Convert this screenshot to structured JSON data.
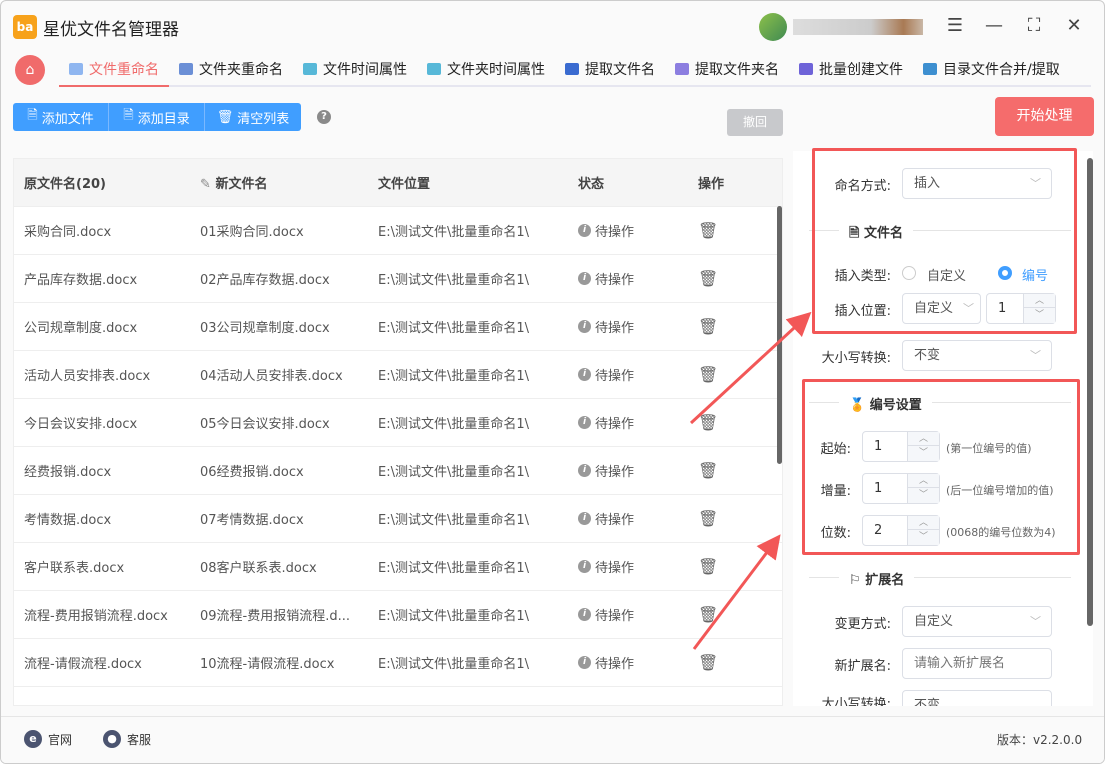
{
  "app": {
    "title": "星优文件名管理器",
    "logo_text": "ba"
  },
  "window_controls": [
    "settings-icon",
    "minimize-icon",
    "maximize-icon",
    "close-icon"
  ],
  "tabs": [
    {
      "label": "文件重命名",
      "active": true,
      "color": "#8fb6f0"
    },
    {
      "label": "文件夹重命名",
      "color": "#6b8fd6"
    },
    {
      "label": "文件时间属性",
      "color": "#57b8d8"
    },
    {
      "label": "文件夹时间属性",
      "color": "#57b8d8"
    },
    {
      "label": "提取文件名",
      "color": "#3a6bd0"
    },
    {
      "label": "提取文件夹名",
      "color": "#8c7ee0"
    },
    {
      "label": "批量创建文件",
      "color": "#6e63d8"
    },
    {
      "label": "目录文件合并/提取",
      "color": "#3d8fd0"
    }
  ],
  "toolbar": {
    "add_file": "添加文件",
    "add_dir": "添加目录",
    "clear_list": "清空列表",
    "help": "?",
    "undo": "撤回",
    "start": "开始处理"
  },
  "table": {
    "headers": [
      "原文件名(20)",
      "新文件名",
      "文件位置",
      "状态",
      "操作"
    ],
    "rows": [
      [
        "采购合同.docx",
        "01采购合同.docx",
        "E:\\测试文件\\批量重命名1\\",
        "待操作"
      ],
      [
        "产品库存数据.docx",
        "02产品库存数据.docx",
        "E:\\测试文件\\批量重命名1\\",
        "待操作"
      ],
      [
        "公司规章制度.docx",
        "03公司规章制度.docx",
        "E:\\测试文件\\批量重命名1\\",
        "待操作"
      ],
      [
        "活动人员安排表.docx",
        "04活动人员安排表.docx",
        "E:\\测试文件\\批量重命名1\\",
        "待操作"
      ],
      [
        "今日会议安排.docx",
        "05今日会议安排.docx",
        "E:\\测试文件\\批量重命名1\\",
        "待操作"
      ],
      [
        "经费报销.docx",
        "06经费报销.docx",
        "E:\\测试文件\\批量重命名1\\",
        "待操作"
      ],
      [
        "考情数据.docx",
        "07考情数据.docx",
        "E:\\测试文件\\批量重命名1\\",
        "待操作"
      ],
      [
        "客户联系表.docx",
        "08客户联系表.docx",
        "E:\\测试文件\\批量重命名1\\",
        "待操作"
      ],
      [
        "流程-费用报销流程.docx",
        "09流程-费用报销流程.d...",
        "E:\\测试文件\\批量重命名1\\",
        "待操作"
      ],
      [
        "流程-请假流程.docx",
        "10流程-请假流程.docx",
        "E:\\测试文件\\批量重命名1\\",
        "待操作"
      ]
    ]
  },
  "panel": {
    "naming_label": "命名方式:",
    "naming_value": "插入",
    "filename_section": "文件名",
    "insert_type_label": "插入类型:",
    "insert_type_options": [
      "自定义",
      "编号"
    ],
    "insert_type_selected": "编号",
    "insert_pos_label": "插入位置:",
    "insert_pos_value": "自定义",
    "insert_pos_num": "1",
    "case_label": "大小写转换:",
    "case_value": "不变",
    "numbering_section": "编号设置",
    "start_label": "起始:",
    "start_value": "1",
    "start_hint": "(第一位编号的值)",
    "step_label": "增量:",
    "step_value": "1",
    "step_hint": "(后一位编号增加的值)",
    "digits_label": "位数:",
    "digits_value": "2",
    "digits_hint": "(0068的编号位数为4)",
    "ext_section": "扩展名",
    "ext_mode_label": "变更方式:",
    "ext_mode_value": "自定义",
    "new_ext_label": "新扩展名:",
    "new_ext_placeholder": "请输入新扩展名",
    "ext_case_label": "大小写转换:",
    "ext_case_value": "不变"
  },
  "footer": {
    "website": "官网",
    "support": "客服",
    "version": "版本：v2.2.0.0"
  },
  "colors": {
    "accent": "#f06b6b",
    "primary": "#409eff",
    "annotation": "#f25757"
  }
}
